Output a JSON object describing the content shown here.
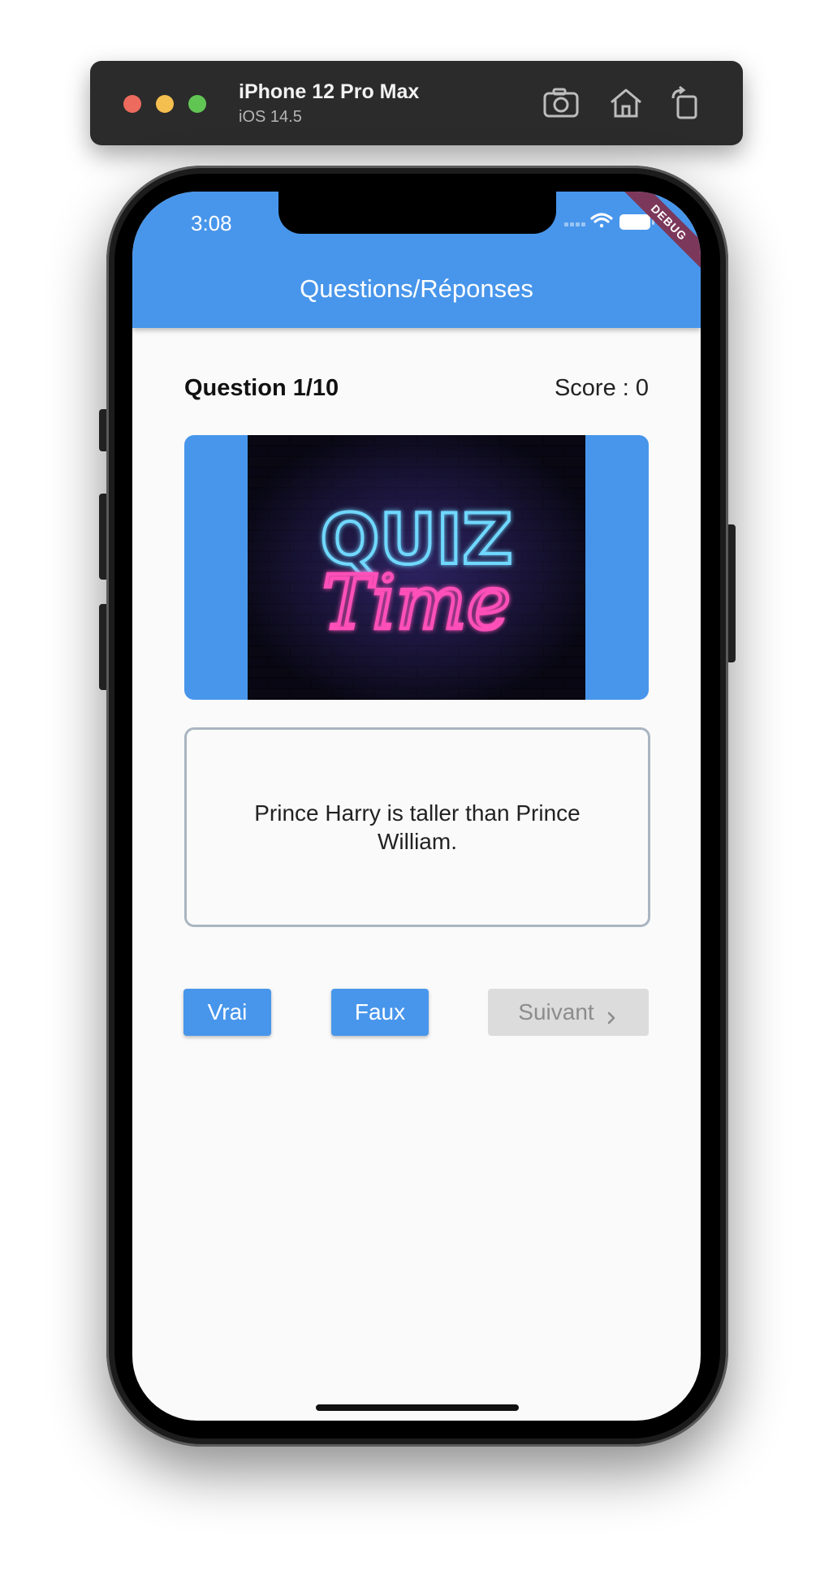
{
  "simulator": {
    "device_name": "iPhone 12 Pro Max",
    "os_version": "iOS 14.5",
    "toolbar_icons": [
      "screenshot-icon",
      "home-icon",
      "rotate-icon"
    ]
  },
  "status_bar": {
    "time": "3:08",
    "icons": [
      "signal-icon",
      "wifi-icon",
      "battery-icon"
    ]
  },
  "debug_banner": "DEBUG",
  "app_bar": {
    "title": "Questions/Réponses",
    "color": "#4896eb"
  },
  "quiz": {
    "question_counter": "Question 1/10",
    "score_label": "Score : 0",
    "image_text_top": "QUIZ",
    "image_text_bottom": "Time",
    "question_text": "Prince Harry is taller than Prince William."
  },
  "buttons": {
    "true_label": "Vrai",
    "false_label": "Faux",
    "next_label": "Suivant",
    "primary_color": "#4896eb",
    "disabled_color": "#dcdcdc"
  }
}
